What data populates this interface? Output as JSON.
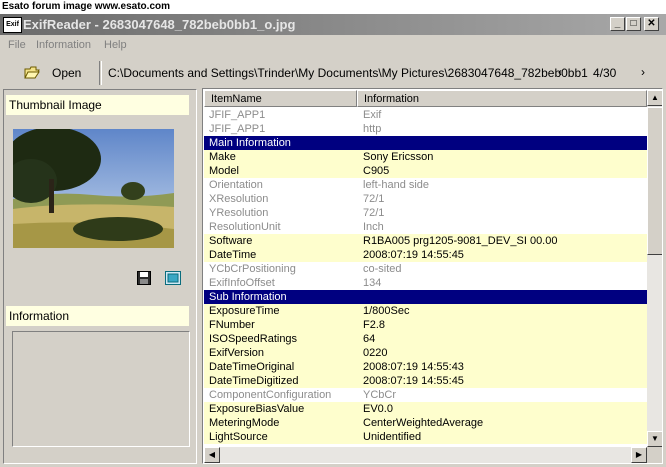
{
  "banner": "Esato forum image www.esato.com",
  "window": {
    "icon_text": "Exif",
    "title": "ExifReader - 2683047648_782beb0bb1_o.jpg",
    "minimize": "_",
    "maximize": "□",
    "close": "✕"
  },
  "menu": [
    "File",
    "Information",
    "Help"
  ],
  "toolbar": {
    "open_label": "Open",
    "path": "C:\\Documents and Settings\\Trinder\\My Documents\\My Pictures\\2683047648_782beb0bb1",
    "prev": "‹",
    "next": "›",
    "counter": "4/30"
  },
  "left_panel": {
    "thumbnail_title": "Thumbnail Image",
    "information_title": "Information"
  },
  "table": {
    "headers": [
      "ItemName",
      "Information"
    ],
    "rows": [
      {
        "name": "JFIF_APP1",
        "value": "Exif",
        "style": "dim"
      },
      {
        "name": "JFIF_APP1",
        "value": "http",
        "style": "dim"
      },
      {
        "name": "Main Information",
        "value": "",
        "style": "sec"
      },
      {
        "name": "Make",
        "value": "Sony Ericsson",
        "style": "hl"
      },
      {
        "name": "Model",
        "value": "C905",
        "style": "hl"
      },
      {
        "name": "Orientation",
        "value": "left-hand side",
        "style": "dim"
      },
      {
        "name": "XResolution",
        "value": "72/1",
        "style": "dim"
      },
      {
        "name": "YResolution",
        "value": "72/1",
        "style": "dim"
      },
      {
        "name": "ResolutionUnit",
        "value": "Inch",
        "style": "dim"
      },
      {
        "name": "Software",
        "value": "R1BA005     prg1205-9081_DEV_SI 00.00",
        "style": "hl"
      },
      {
        "name": "DateTime",
        "value": "2008:07:19 14:55:45",
        "style": "hl"
      },
      {
        "name": "YCbCrPositioning",
        "value": "co-sited",
        "style": "dim"
      },
      {
        "name": "ExifInfoOffset",
        "value": "134",
        "style": "dim"
      },
      {
        "name": "Sub Information",
        "value": "",
        "style": "sec"
      },
      {
        "name": "ExposureTime",
        "value": "1/800Sec",
        "style": "hl"
      },
      {
        "name": "FNumber",
        "value": "F2.8",
        "style": "hl"
      },
      {
        "name": "ISOSpeedRatings",
        "value": "64",
        "style": "hl"
      },
      {
        "name": "ExifVersion",
        "value": "0220",
        "style": "hl"
      },
      {
        "name": "DateTimeOriginal",
        "value": "2008:07:19 14:55:43",
        "style": "hl"
      },
      {
        "name": "DateTimeDigitized",
        "value": "2008:07:19 14:55:45",
        "style": "hl"
      },
      {
        "name": "ComponentConfiguration",
        "value": "YCbCr",
        "style": "dim"
      },
      {
        "name": "ExposureBiasValue",
        "value": "EV0.0",
        "style": "hl"
      },
      {
        "name": "MeteringMode",
        "value": "CenterWeightedAverage",
        "style": "hl"
      },
      {
        "name": "LightSource",
        "value": "Unidentified",
        "style": "hl"
      }
    ]
  },
  "scroll": {
    "up": "▲",
    "down": "▼",
    "left": "◀",
    "right": "▶"
  }
}
